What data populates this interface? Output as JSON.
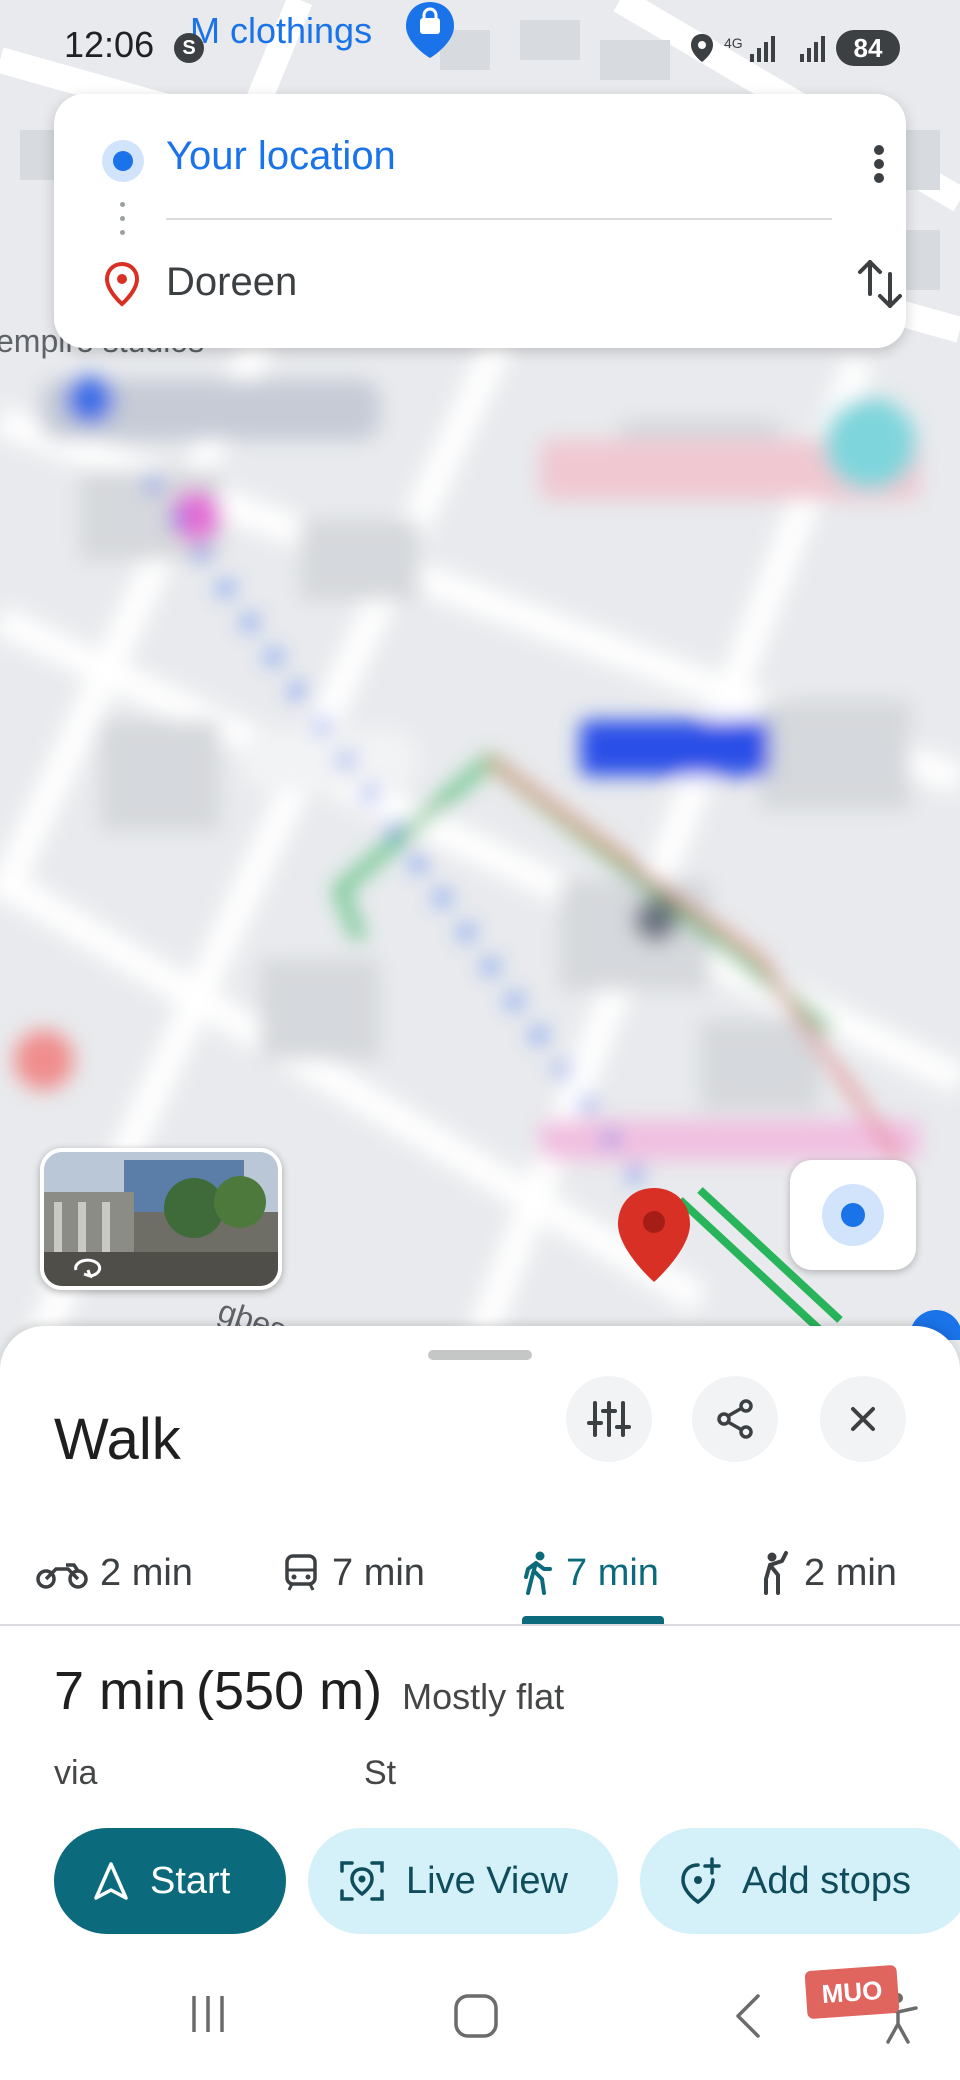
{
  "status_bar": {
    "time": "12:06",
    "s_badge": "S",
    "battery": "84",
    "map_poi_top": "M clothings"
  },
  "route": {
    "from": "Your location",
    "to": "Doreen"
  },
  "map": {
    "label_empire": "empire studios",
    "label_street_bottom": "gbes"
  },
  "sheet": {
    "title": "Walk",
    "modes": [
      {
        "icon": "motorcycle-icon",
        "label": "2 min"
      },
      {
        "icon": "transit-icon",
        "label": "7 min"
      },
      {
        "icon": "walk-icon",
        "label": "7 min",
        "active": true
      },
      {
        "icon": "ride-hail-icon",
        "label": "2 min"
      }
    ],
    "summary": {
      "time": "7 min",
      "distance": "(550 m)",
      "terrain": "Mostly flat"
    },
    "via": {
      "label": "via",
      "street": "St"
    },
    "actions": {
      "start": "Start",
      "live_view": "Live View",
      "add_stops": "Add stops"
    }
  },
  "watermark": "MUO",
  "colors": {
    "accent": "#0b6b7d",
    "blue": "#1a73e8",
    "pin_red": "#d93025",
    "chip_bg": "#d4f1f9"
  }
}
